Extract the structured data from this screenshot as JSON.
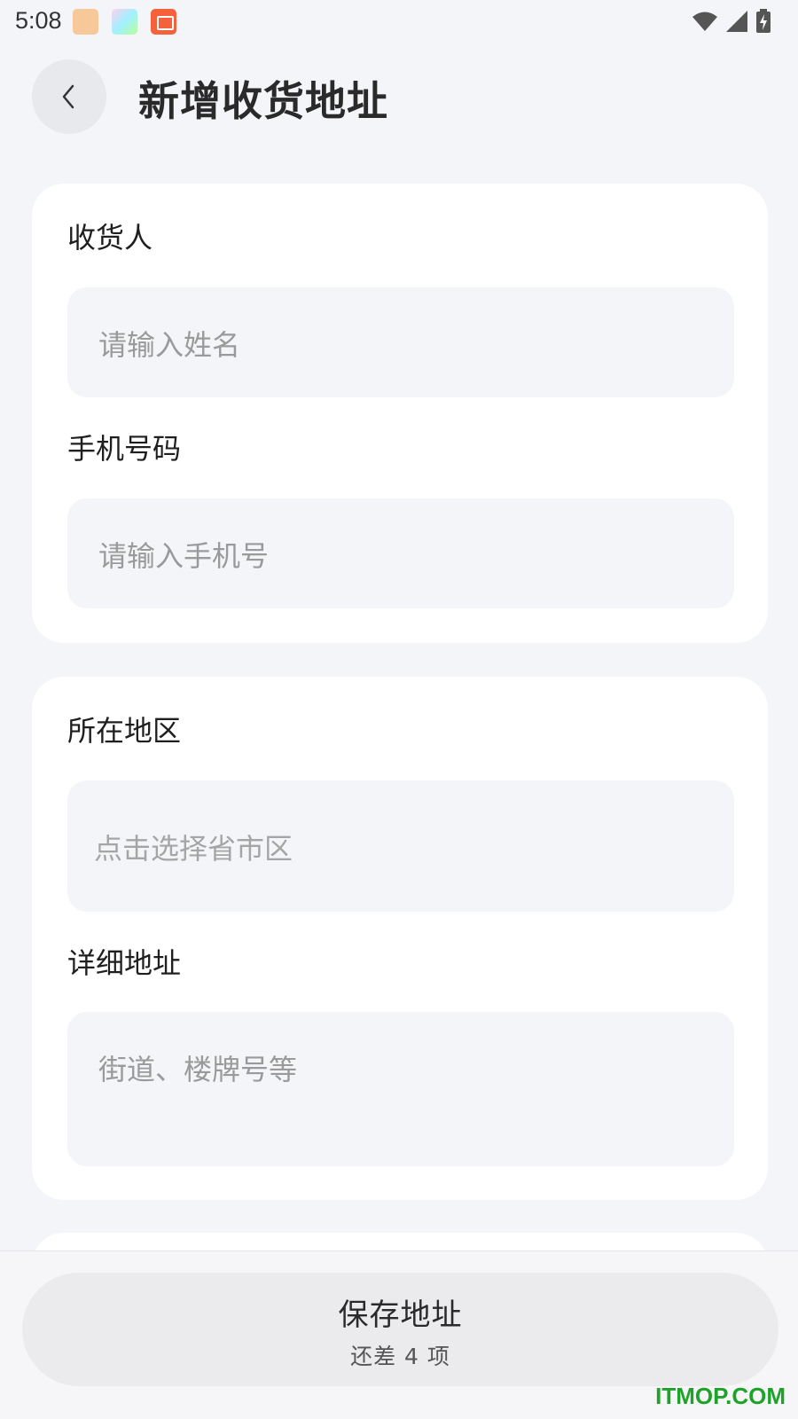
{
  "status_bar": {
    "time": "5:08",
    "notification_icons": [
      "cat-app-icon",
      "gallery-app-icon",
      "book-app-icon"
    ],
    "system_icons": [
      "wifi-icon",
      "signal-icon",
      "battery-charging-icon"
    ]
  },
  "header": {
    "back_icon": "chevron-left-icon",
    "title": "新增收货地址"
  },
  "contact_card": {
    "receiver_label": "收货人",
    "receiver_placeholder": "请输入姓名",
    "phone_label": "手机号码",
    "phone_placeholder": "请输入手机号"
  },
  "address_card": {
    "region_label": "所在地区",
    "region_placeholder": "点击选择省市区",
    "detail_label": "详细地址",
    "detail_placeholder": "街道、楼牌号等"
  },
  "bottom_bar": {
    "save_label": "保存地址",
    "remaining_text": "还差 4 项"
  },
  "watermark": "ITMOP.COM",
  "colors": {
    "background": "#f4f5f9",
    "card": "#ffffff",
    "input": "#f4f5f9",
    "watermark": "#1fa22a"
  }
}
